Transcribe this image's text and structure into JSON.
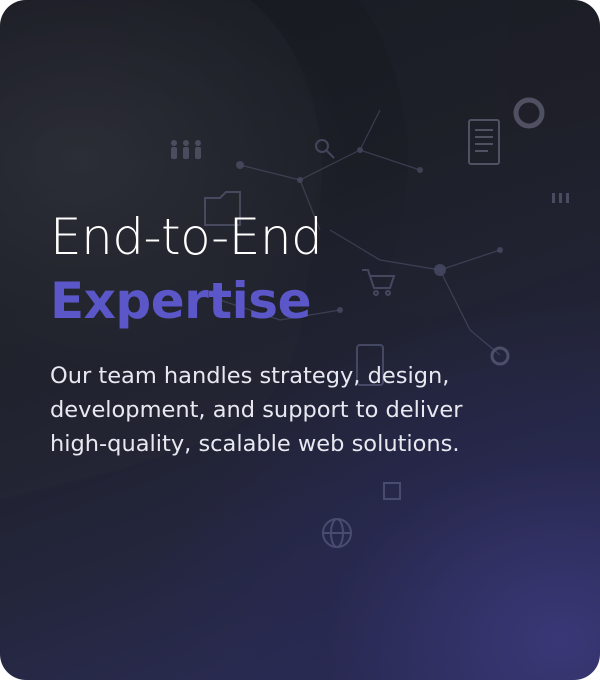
{
  "card": {
    "title_line1": "End-to-End",
    "title_line2": "Expertise",
    "description": "Our team handles strategy, design, development, and support to deliver high-quality, scalable web solutions."
  },
  "colors": {
    "accent": "#5b57c8",
    "text": "#ffffff",
    "background_dark": "#17191f",
    "background_glow": "#2e2f5e"
  },
  "icons": [
    "people-icon",
    "document-icon",
    "chart-ring-icon",
    "folder-icon",
    "shopping-cart-icon",
    "globe-icon",
    "search-icon",
    "person-group-icon"
  ]
}
